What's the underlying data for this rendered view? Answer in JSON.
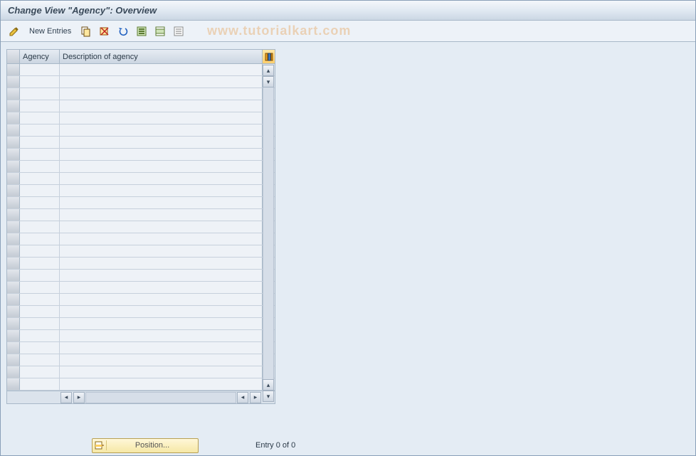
{
  "title": "Change View \"Agency\": Overview",
  "watermark": "www.tutorialkart.com",
  "toolbar": {
    "new_entries": "New Entries"
  },
  "table": {
    "columns": {
      "agency": "Agency",
      "description": "Description of agency"
    },
    "row_count": 27,
    "rows": []
  },
  "footer": {
    "position_label": "Position...",
    "entry_status": "Entry 0 of 0"
  }
}
